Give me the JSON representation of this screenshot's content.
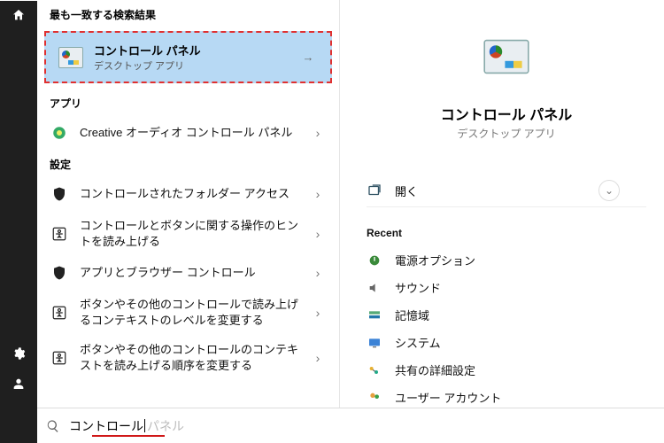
{
  "left": {
    "header_best_match": "最も一致する検索結果",
    "top_result": {
      "title": "コントロール パネル",
      "subtitle": "デスクトップ アプリ"
    },
    "header_apps": "アプリ",
    "apps": [
      {
        "label": "Creative オーディオ コントロール パネル"
      }
    ],
    "header_settings": "設定",
    "settings": [
      {
        "label": "コントロールされたフォルダー アクセス"
      },
      {
        "label": "コントロールとボタンに関する操作のヒントを読み上げる"
      },
      {
        "label": "アプリとブラウザー コントロール"
      },
      {
        "label": "ボタンやその他のコントロールで読み上げるコンテキストのレベルを変更する"
      },
      {
        "label": "ボタンやその他のコントロールのコンテキストを読み上げる順序を変更する"
      }
    ]
  },
  "search": {
    "value": "コントロール",
    "ghost": "パネル"
  },
  "right": {
    "title": "コントロール パネル",
    "subtitle": "デスクトップ アプリ",
    "open_label": "開く",
    "recent_header": "Recent",
    "recent": [
      {
        "label": "電源オプション"
      },
      {
        "label": "サウンド"
      },
      {
        "label": "記憶域"
      },
      {
        "label": "システム"
      },
      {
        "label": "共有の詳細設定"
      },
      {
        "label": "ユーザー アカウント"
      }
    ]
  }
}
